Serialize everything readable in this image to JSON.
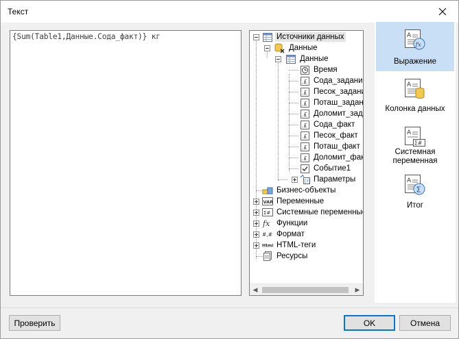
{
  "window": {
    "title": "Текст"
  },
  "editor": {
    "expression": "{Sum(Table1,Данные.Сода_факт)} кг"
  },
  "tree": {
    "root": "Источники данных",
    "datasource": "Данные",
    "table": "Данные",
    "fields": [
      "Время",
      "Сода_задание",
      "Песок_задание",
      "Поташ_задание",
      "Доломит_задание",
      "Сода_факт",
      "Песок_факт",
      "Поташ_факт",
      "Доломит_факт",
      "Событие1"
    ],
    "parameters": "Параметры",
    "business_objects": "Бизнес-объекты",
    "variables": "Переменные",
    "system_variables": "Системные переменные",
    "functions": "Функции",
    "format": "Формат",
    "html_tags": "HTML-теги",
    "resources": "Ресурсы"
  },
  "categories": {
    "expression": "Выражение",
    "data_column": "Колонка данных",
    "system_variable": "Системная переменная",
    "total": "Итог"
  },
  "buttons": {
    "check": "Проверить",
    "ok": "OK",
    "cancel": "Отмена"
  },
  "colors": {
    "active_category": "#c9dff6",
    "accent": "#0078d7"
  }
}
